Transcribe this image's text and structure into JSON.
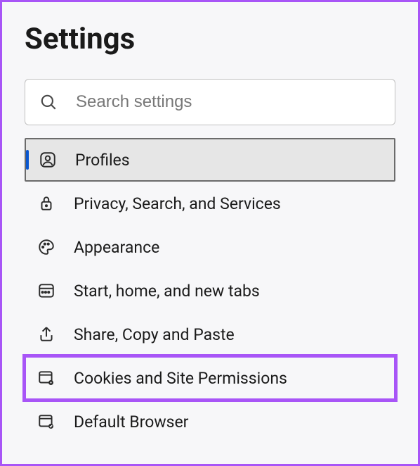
{
  "header": {
    "title": "Settings"
  },
  "search": {
    "placeholder": "Search settings"
  },
  "nav": {
    "items": [
      {
        "icon": "profile-icon",
        "label": "Profiles",
        "selected": true
      },
      {
        "icon": "lock-icon",
        "label": "Privacy, Search, and Services"
      },
      {
        "icon": "palette-icon",
        "label": "Appearance"
      },
      {
        "icon": "window-icon",
        "label": "Start, home, and new tabs"
      },
      {
        "icon": "share-icon",
        "label": "Share, Copy and Paste"
      },
      {
        "icon": "cookies-icon",
        "label": "Cookies and Site Permissions",
        "highlighted": true
      },
      {
        "icon": "browser-check-icon",
        "label": "Default Browser"
      }
    ]
  }
}
